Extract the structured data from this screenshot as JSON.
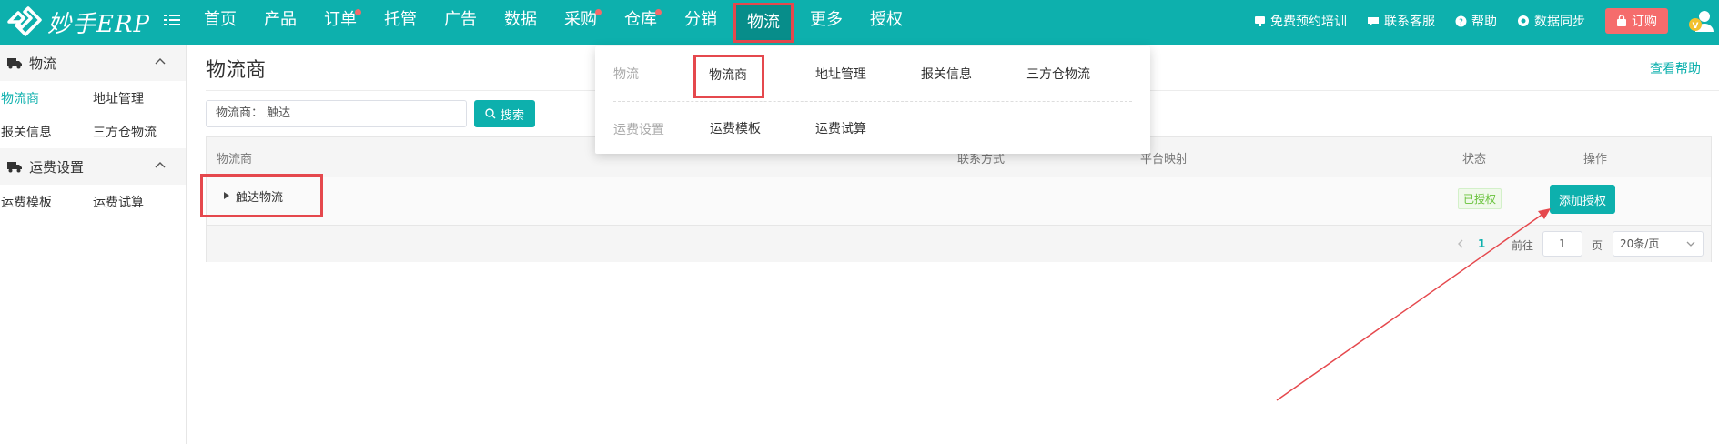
{
  "brand": {
    "name": "妙手ERP"
  },
  "nav": {
    "items": [
      {
        "label": "首页",
        "dot": false
      },
      {
        "label": "产品",
        "dot": false
      },
      {
        "label": "订单",
        "dot": true
      },
      {
        "label": "托管",
        "dot": false
      },
      {
        "label": "广告",
        "dot": false
      },
      {
        "label": "数据",
        "dot": false
      },
      {
        "label": "采购",
        "dot": true
      },
      {
        "label": "仓库",
        "dot": true
      },
      {
        "label": "分销",
        "dot": false
      },
      {
        "label": "物流",
        "dot": false,
        "active": true
      },
      {
        "label": "更多",
        "dot": false
      },
      {
        "label": "授权",
        "dot": false
      }
    ],
    "right": {
      "training": "免费预约培训",
      "support": "联系客服",
      "help": "帮助",
      "sync": "数据同步",
      "order": "订购"
    }
  },
  "sidebar": {
    "group1": "物流",
    "group1_items": [
      "物流商",
      "地址管理",
      "报关信息",
      "三方仓物流"
    ],
    "group2": "运费设置",
    "group2_items": [
      "运费模板",
      "运费试算"
    ]
  },
  "main": {
    "title": "物流商",
    "help": "查看帮助",
    "search_value": "物流商： 触达",
    "search_button": "搜索",
    "columns": [
      "物流商",
      "联系方式",
      "平台映射",
      "状态",
      "操作"
    ],
    "row": {
      "name": "触达物流",
      "status": "已授权",
      "action": "添加授权"
    },
    "pager": {
      "current": "1",
      "goto_label": "前往",
      "goto_value": "1",
      "page_label": "页",
      "page_size": "20条/页"
    }
  },
  "dropdown": {
    "cat1": "物流",
    "cat1_items": [
      "物流商",
      "地址管理",
      "报关信息",
      "三方仓物流"
    ],
    "cat2": "运费设置",
    "cat2_items": [
      "运费模板",
      "运费试算"
    ]
  },
  "colors": {
    "primary": "#0db0ad",
    "highlight": "#e5484d",
    "order": "#f56c6c"
  }
}
